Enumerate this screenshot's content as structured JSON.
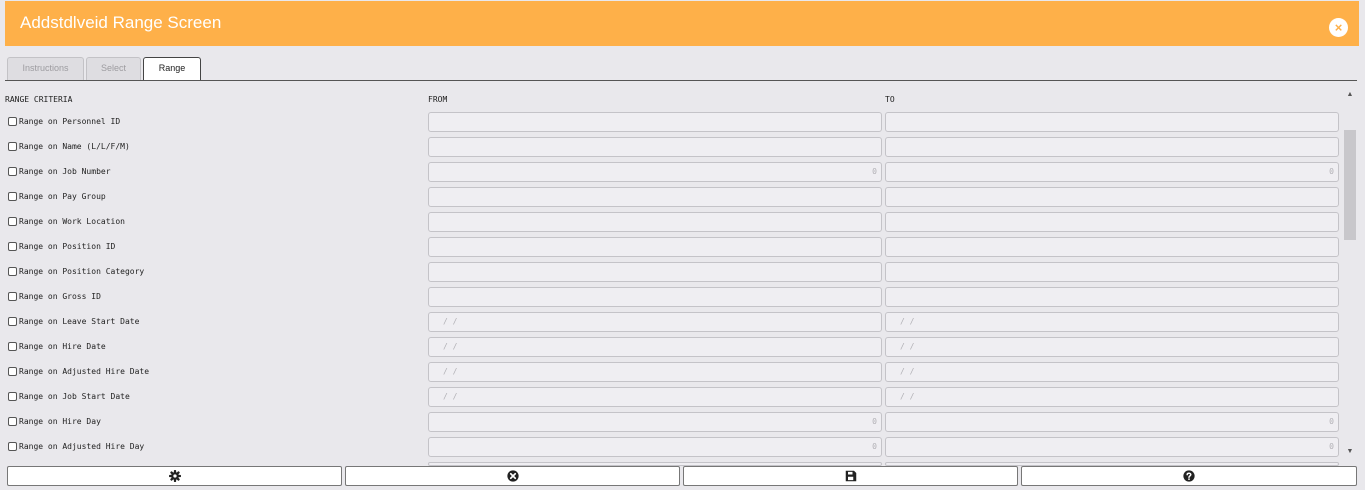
{
  "window": {
    "title": "Addstdlveid Range Screen",
    "close_icon": "close-icon"
  },
  "tabs": [
    {
      "label": "Instructions",
      "active": false
    },
    {
      "label": "Select",
      "active": false
    },
    {
      "label": "Range",
      "active": true
    }
  ],
  "headers": {
    "criteria": "RANGE CRITERIA",
    "from": "FROM",
    "to": "TO"
  },
  "rows": [
    {
      "label": "Range on Personnel ID",
      "checked": false,
      "from": "",
      "to": ""
    },
    {
      "label": "Range on Name (L/L/F/M)",
      "checked": false,
      "from": "",
      "to": ""
    },
    {
      "label": "Range on Job Number",
      "checked": false,
      "from": "0",
      "to": "0"
    },
    {
      "label": "Range on Pay Group",
      "checked": false,
      "from": "",
      "to": ""
    },
    {
      "label": "Range on Work Location",
      "checked": false,
      "from": "",
      "to": ""
    },
    {
      "label": "Range on Position ID",
      "checked": false,
      "from": "",
      "to": ""
    },
    {
      "label": "Range on Position Category",
      "checked": false,
      "from": "",
      "to": ""
    },
    {
      "label": "Range on Gross ID",
      "checked": false,
      "from": "",
      "to": ""
    },
    {
      "label": "Range on Leave Start Date",
      "checked": false,
      "from": "/  /",
      "to": "/  /"
    },
    {
      "label": "Range on Hire Date",
      "checked": false,
      "from": "/  /",
      "to": "/  /"
    },
    {
      "label": "Range on Adjusted Hire Date",
      "checked": false,
      "from": "/  /",
      "to": "/  /"
    },
    {
      "label": "Range on Job Start Date",
      "checked": false,
      "from": "/  /",
      "to": "/  /"
    },
    {
      "label": "Range on Hire Day",
      "checked": false,
      "from": "0",
      "to": "0"
    },
    {
      "label": "Range on Adjusted Hire Day",
      "checked": false,
      "from": "0",
      "to": "0"
    }
  ],
  "footer": [
    {
      "icon": "gear-icon"
    },
    {
      "icon": "cancel-icon"
    },
    {
      "icon": "save-icon"
    },
    {
      "icon": "help-icon"
    }
  ],
  "colors": {
    "header": "#feb049",
    "background": "#e9e8ec"
  }
}
